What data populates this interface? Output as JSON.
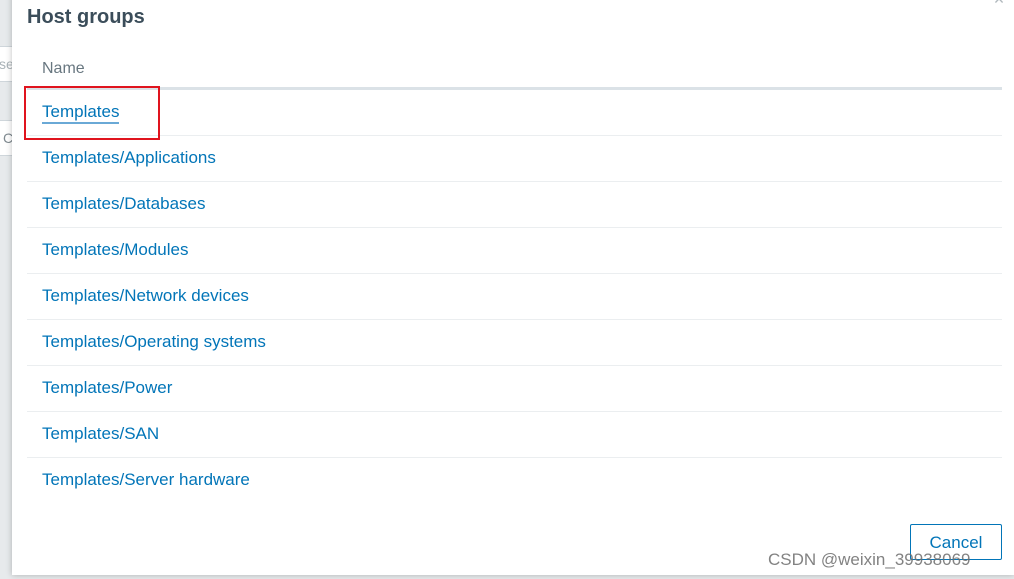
{
  "background": {
    "input_fragment": "se",
    "button_fragment": "C"
  },
  "dialog": {
    "title": "Host groups",
    "close_glyph": "×",
    "table": {
      "column_header": "Name",
      "rows": [
        "Templates",
        "Templates/Applications",
        "Templates/Databases",
        "Templates/Modules",
        "Templates/Network devices",
        "Templates/Operating systems",
        "Templates/Power",
        "Templates/SAN",
        "Templates/Server hardware"
      ]
    },
    "cancel_label": "Cancel"
  },
  "watermark": "CSDN @weixin_39938069",
  "colors": {
    "link": "#0275b8",
    "title": "#3b4d5a",
    "highlight": "#e0141e"
  }
}
